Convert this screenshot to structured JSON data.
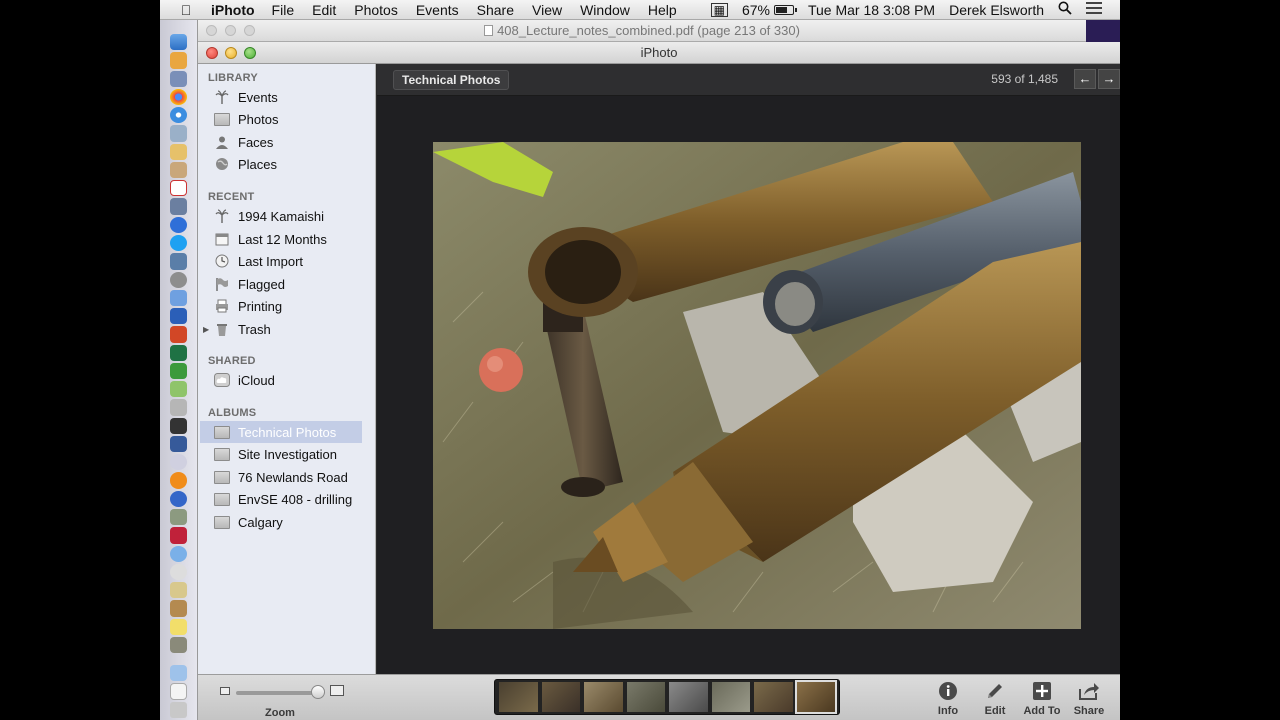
{
  "menubar": {
    "app": "iPhoto",
    "items": [
      "File",
      "Edit",
      "Photos",
      "Events",
      "Share",
      "View",
      "Window",
      "Help"
    ],
    "battery": "67%",
    "datetime": "Tue Mar 18  3:08 PM",
    "user": "Derek Elsworth"
  },
  "pdf_window": {
    "title": "408_Lecture_notes_combined.pdf (page 213 of 330)"
  },
  "window": {
    "title": "iPhoto"
  },
  "sidebar": {
    "library_header": "LIBRARY",
    "library": [
      {
        "label": "Events",
        "icon": "palm-tree-icon"
      },
      {
        "label": "Photos",
        "icon": "photos-icon"
      },
      {
        "label": "Faces",
        "icon": "person-icon"
      },
      {
        "label": "Places",
        "icon": "globe-icon"
      }
    ],
    "recent_header": "RECENT",
    "recent": [
      {
        "label": "1994 Kamaishi",
        "icon": "palm-tree-icon"
      },
      {
        "label": "Last 12 Months",
        "icon": "calendar-icon"
      },
      {
        "label": "Last Import",
        "icon": "clock-icon"
      },
      {
        "label": "Flagged",
        "icon": "flag-icon"
      },
      {
        "label": "Printing",
        "icon": "printer-icon"
      },
      {
        "label": "Trash",
        "icon": "trash-icon"
      }
    ],
    "shared_header": "SHARED",
    "shared": [
      {
        "label": "iCloud",
        "icon": "cloud-icon"
      }
    ],
    "albums_header": "ALBUMS",
    "albums": [
      {
        "label": "Technical Photos",
        "selected": true
      },
      {
        "label": "Site Investigation"
      },
      {
        "label": "76 Newlands Road"
      },
      {
        "label": "EnvSE 408 - drilling"
      },
      {
        "label": "Calgary"
      }
    ]
  },
  "main": {
    "album_title": "Technical Photos",
    "counter": "593 of 1,485",
    "photo_description_icon": "photo-drill-pipes"
  },
  "toolbar": {
    "zoom_label": "Zoom",
    "zoom_level": 0.93,
    "buttons": [
      {
        "label": "Info",
        "icon": "info-icon"
      },
      {
        "label": "Edit",
        "icon": "pencil-icon"
      },
      {
        "label": "Add To",
        "icon": "plus-icon"
      },
      {
        "label": "Share",
        "icon": "share-icon"
      }
    ]
  },
  "colors": {
    "selection": "#c3cde6",
    "main_bg": "#1f1f22",
    "sidebar_bg": "#e8ebf3"
  }
}
